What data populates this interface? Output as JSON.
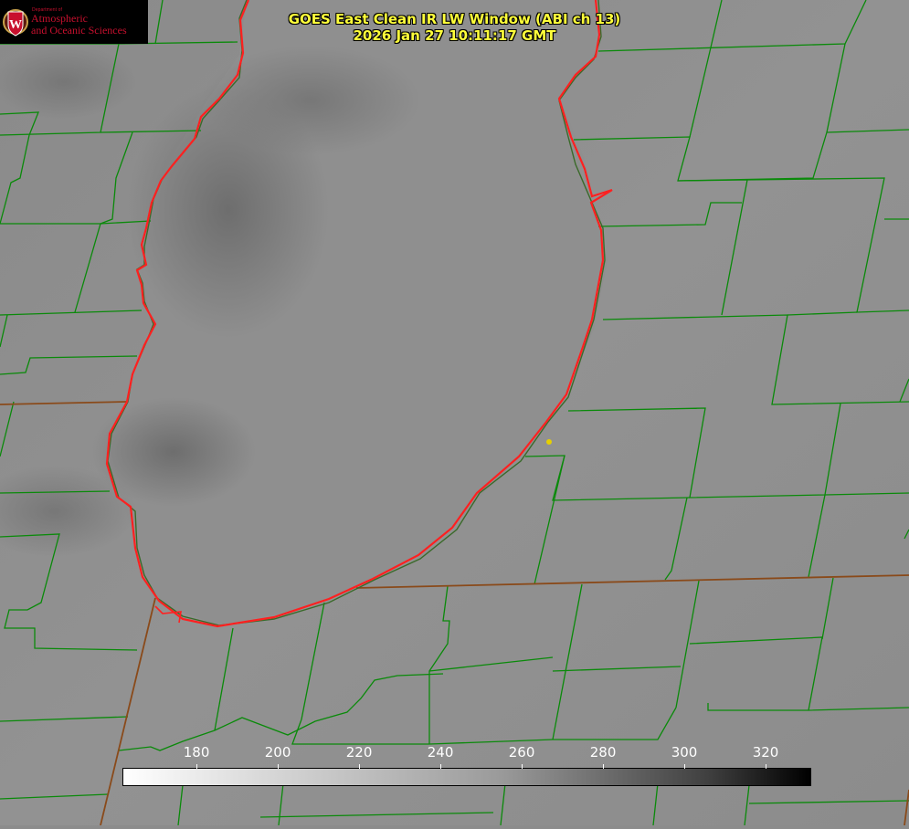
{
  "header": {
    "title_line1": "GOES East Clean IR LW Window (ABI ch 13)",
    "title_line2": "2026 Jan 27 10:11:17 GMT"
  },
  "logo": {
    "dept_text": "Department of",
    "line1": "Atmospheric",
    "line2": "and Oceanic Sciences",
    "crest_letter": "W",
    "color": "#c8102e"
  },
  "colorbar": {
    "ticks": [
      "180",
      "200",
      "220",
      "240",
      "260",
      "280",
      "300",
      "320"
    ],
    "min": 162,
    "max": 331,
    "tick_values": [
      180,
      200,
      220,
      240,
      260,
      280,
      300,
      320
    ],
    "colors": [
      "#ffffff",
      "#000000"
    ]
  },
  "map": {
    "lake_outline_color": "#ff2020",
    "county_line_color": "#0a8a0a",
    "state_line_color": "#8a4a1a",
    "marker_color": "#e6d000"
  }
}
